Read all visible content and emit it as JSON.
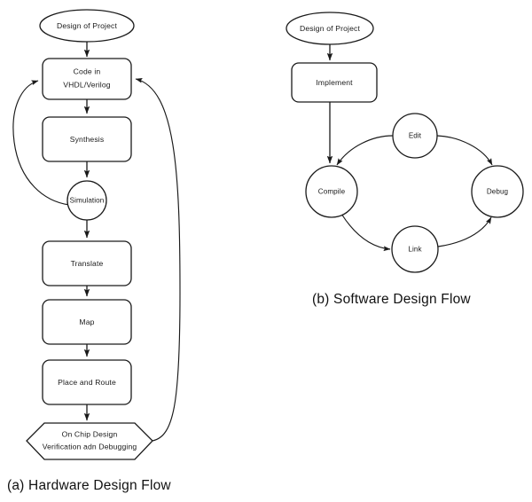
{
  "figure": {
    "background_color": "#ffffff",
    "stroke_color": "#1a1a1a",
    "text_color": "#1a1a1a"
  },
  "hardware_flow": {
    "caption": "(a) Hardware Design Flow",
    "nodes": {
      "start": {
        "label": "Design of Project",
        "shape": "ellipse"
      },
      "code": {
        "label_line1": "Code in",
        "label_line2": "VHDL/Verilog",
        "shape": "rounded-rect"
      },
      "synthesis": {
        "label": "Synthesis",
        "shape": "rounded-rect"
      },
      "simulation": {
        "label": "Simulation",
        "shape": "circle"
      },
      "translate": {
        "label": "Translate",
        "shape": "rounded-rect"
      },
      "map": {
        "label": "Map",
        "shape": "rounded-rect"
      },
      "place_route": {
        "label": "Place and Route",
        "shape": "rounded-rect"
      },
      "onchip": {
        "label_line1": "On Chip Design",
        "label_line2": "Verification adn Debugging",
        "shape": "hexagon"
      }
    },
    "edges": [
      {
        "from": "start",
        "to": "code",
        "style": "straight-arrow"
      },
      {
        "from": "code",
        "to": "synthesis",
        "style": "straight-arrow"
      },
      {
        "from": "synthesis",
        "to": "simulation",
        "style": "straight-arrow"
      },
      {
        "from": "simulation",
        "to": "code",
        "style": "curved-feedback-left"
      },
      {
        "from": "simulation",
        "to": "translate",
        "style": "straight-arrow"
      },
      {
        "from": "translate",
        "to": "map",
        "style": "straight-arrow"
      },
      {
        "from": "map",
        "to": "place_route",
        "style": "straight-arrow"
      },
      {
        "from": "place_route",
        "to": "onchip",
        "style": "straight-arrow"
      },
      {
        "from": "onchip",
        "to": "code",
        "style": "curved-feedback-right"
      }
    ]
  },
  "software_flow": {
    "caption": "(b) Software Design Flow",
    "nodes": {
      "start": {
        "label": "Design of Project",
        "shape": "ellipse"
      },
      "implement": {
        "label": "Implement",
        "shape": "rounded-rect"
      },
      "compile": {
        "label": "Compile",
        "shape": "circle"
      },
      "edit": {
        "label": "Edit",
        "shape": "circle"
      },
      "link": {
        "label": "Link",
        "shape": "circle"
      },
      "debug": {
        "label": "Debug",
        "shape": "circle"
      }
    },
    "edges": [
      {
        "from": "start",
        "to": "implement",
        "style": "straight-arrow"
      },
      {
        "from": "implement",
        "to": "compile",
        "style": "straight-arrow"
      },
      {
        "from": "edit",
        "to": "compile",
        "style": "curved-arrow"
      },
      {
        "from": "compile",
        "to": "link",
        "style": "curved-arrow"
      },
      {
        "from": "link",
        "to": "debug",
        "style": "curved-arrow"
      },
      {
        "from": "edit",
        "to": "debug",
        "style": "curved-arrow"
      }
    ]
  }
}
